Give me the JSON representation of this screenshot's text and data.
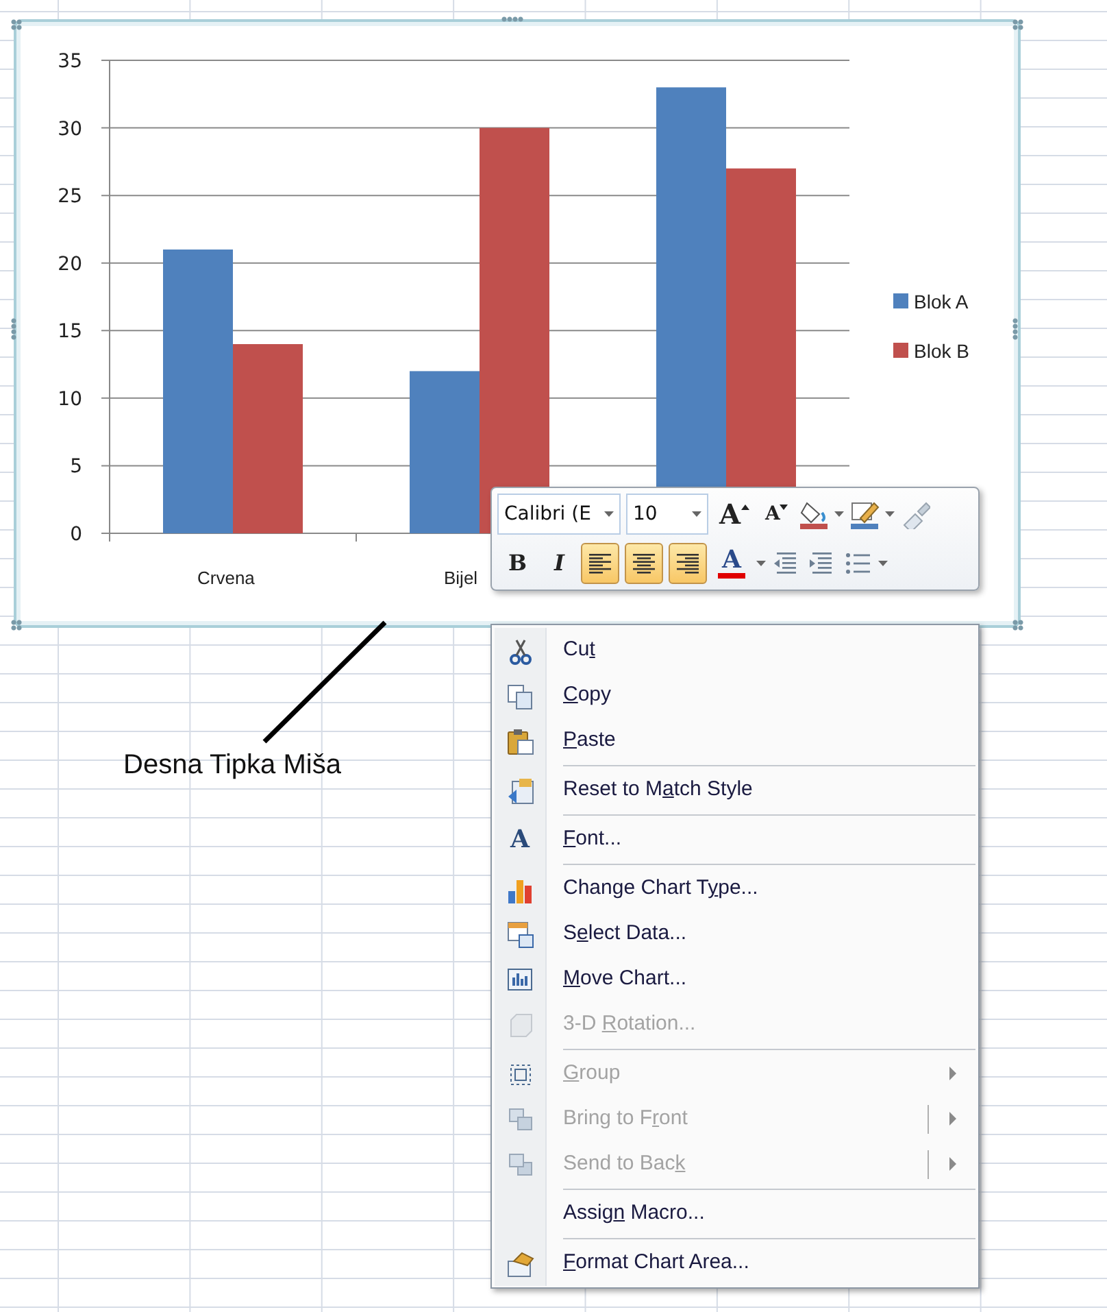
{
  "chart": {
    "chart_data": {
      "type": "bar",
      "categories": [
        "Crvena",
        "Bijel",
        null
      ],
      "series": [
        {
          "name": "Blok A",
          "color": "#4f81bd",
          "values": [
            21,
            12,
            33
          ]
        },
        {
          "name": "Blok B",
          "color": "#c0504d",
          "values": [
            14,
            30,
            27
          ]
        }
      ],
      "ylim": [
        0,
        35
      ],
      "yticks": [
        0,
        5,
        10,
        15,
        20,
        25,
        30,
        35
      ],
      "grid": true,
      "legend": true
    }
  },
  "annotation": {
    "text": "Desna Tipka Miša"
  },
  "mini_toolbar": {
    "font_field": {
      "value": "Calibri (E"
    },
    "size_field": {
      "value": "10"
    },
    "grow_font": {
      "glyph": "A"
    },
    "shrink_font": {
      "glyph": "A"
    },
    "bold": {
      "glyph": "B"
    },
    "italic": {
      "glyph": "I"
    },
    "align_buttons": [
      {
        "kind": "left",
        "selected": true
      },
      {
        "kind": "center",
        "selected": true
      },
      {
        "kind": "right",
        "selected": true
      }
    ],
    "font_color": {
      "glyph": "A",
      "color": "#e00000"
    }
  },
  "context_menu": [
    {
      "kind": "item",
      "before": "Cu",
      "key": "t",
      "disabled": false
    },
    {
      "kind": "item",
      "key": "C",
      "after": "opy",
      "disabled": false
    },
    {
      "kind": "item",
      "key": "P",
      "after": "aste",
      "disabled": false
    },
    {
      "kind": "separator"
    },
    {
      "kind": "item",
      "before": "Reset to M",
      "key": "a",
      "after": "tch Style",
      "disabled": false
    },
    {
      "kind": "separator"
    },
    {
      "kind": "item",
      "key": "F",
      "after": "ont...",
      "disabled": false,
      "glyph": "A"
    },
    {
      "kind": "separator"
    },
    {
      "kind": "item",
      "before": "Change Chart T",
      "key": "y",
      "after": "pe...",
      "disabled": false
    },
    {
      "kind": "item",
      "before": "S",
      "key": "e",
      "after": "lect Data...",
      "disabled": false
    },
    {
      "kind": "item",
      "key": "M",
      "after": "ove Chart...",
      "disabled": false
    },
    {
      "kind": "item",
      "before": "3-D ",
      "key": "R",
      "after": "otation...",
      "disabled": true
    },
    {
      "kind": "separator"
    },
    {
      "kind": "item",
      "key": "G",
      "after": "roup",
      "disabled": true,
      "submenu": true,
      "split": false
    },
    {
      "kind": "item",
      "before": "Bring to F",
      "key": "r",
      "after": "ont",
      "disabled": true,
      "submenu": true,
      "split": true
    },
    {
      "kind": "item",
      "before": "Send to Bac",
      "key": "k",
      "disabled": true,
      "submenu": true,
      "split": true
    },
    {
      "kind": "separator"
    },
    {
      "kind": "item",
      "before": "Assig",
      "key": "n",
      "after": " Macro...",
      "disabled": false
    },
    {
      "kind": "separator"
    },
    {
      "kind": "item",
      "key": "F",
      "after": "ormat Chart Area...",
      "disabled": false
    }
  ]
}
